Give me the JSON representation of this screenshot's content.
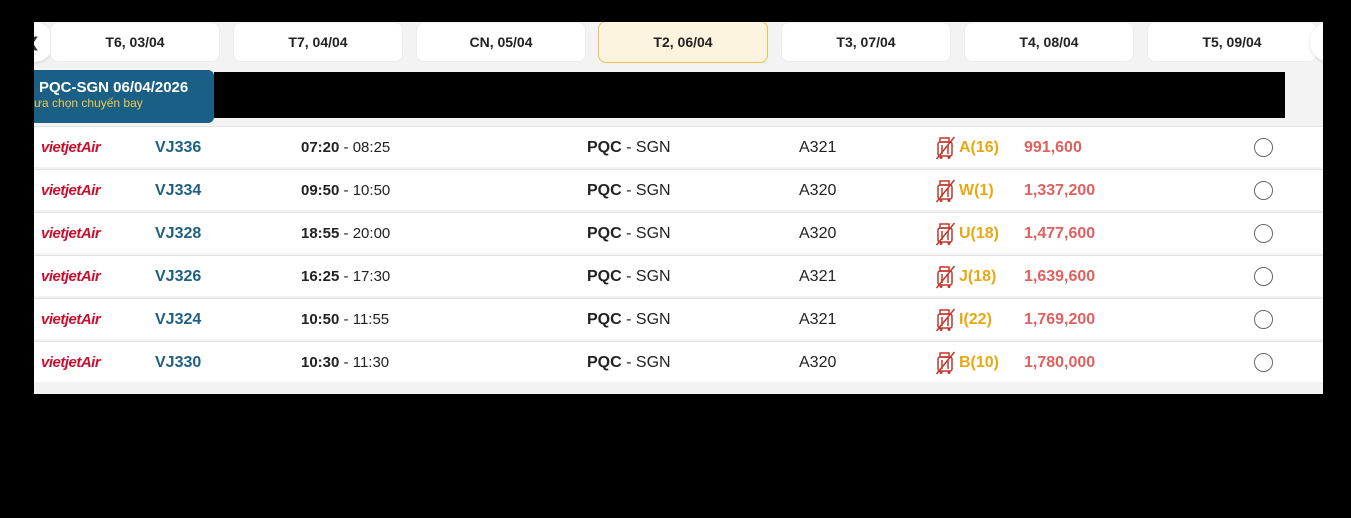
{
  "dates": [
    {
      "label": "T6, 03/04",
      "active": false
    },
    {
      "label": "T7, 04/04",
      "active": false
    },
    {
      "label": "CN, 05/04",
      "active": false
    },
    {
      "label": "T2, 06/04",
      "active": true
    },
    {
      "label": "T3, 07/04",
      "active": false
    },
    {
      "label": "T4, 08/04",
      "active": false
    },
    {
      "label": "T5, 09/04",
      "active": false
    }
  ],
  "route_header": {
    "title": "PQC-SGN 06/04/2026",
    "subtitle": "ưa chọn chuyến bay"
  },
  "airline_logo_text": "vietjetAir",
  "flights": [
    {
      "flight_no": "VJ336",
      "dep": "07:20",
      "arr": "08:25",
      "from": "PQC",
      "to": "SGN",
      "aircraft": "A321",
      "fare_class": "A(16)",
      "price": "991,600"
    },
    {
      "flight_no": "VJ334",
      "dep": "09:50",
      "arr": "10:50",
      "from": "PQC",
      "to": "SGN",
      "aircraft": "A320",
      "fare_class": "W(1)",
      "price": "1,337,200"
    },
    {
      "flight_no": "VJ328",
      "dep": "18:55",
      "arr": "20:00",
      "from": "PQC",
      "to": "SGN",
      "aircraft": "A320",
      "fare_class": "U(18)",
      "price": "1,477,600"
    },
    {
      "flight_no": "VJ326",
      "dep": "16:25",
      "arr": "17:30",
      "from": "PQC",
      "to": "SGN",
      "aircraft": "A321",
      "fare_class": "J(18)",
      "price": "1,639,600"
    },
    {
      "flight_no": "VJ324",
      "dep": "10:50",
      "arr": "11:55",
      "from": "PQC",
      "to": "SGN",
      "aircraft": "A321",
      "fare_class": "I(22)",
      "price": "1,769,200"
    },
    {
      "flight_no": "VJ330",
      "dep": "10:30",
      "arr": "11:30",
      "from": "PQC",
      "to": "SGN",
      "aircraft": "A320",
      "fare_class": "B(10)",
      "price": "1,780,000"
    }
  ],
  "colors": {
    "route_badge_bg": "#195f86",
    "flight_no": "#1f5f82",
    "fare_class": "#e8a814",
    "price": "#e06060",
    "airline_red": "#c8102e",
    "active_tab_bg": "#fdf4df",
    "active_tab_border": "#f0c04a"
  },
  "icons": {
    "nav_prev": "chevron-left-icon",
    "nav_next": "chevron-right-icon",
    "baggage": "no-checked-baggage-icon",
    "select": "radio-button"
  }
}
